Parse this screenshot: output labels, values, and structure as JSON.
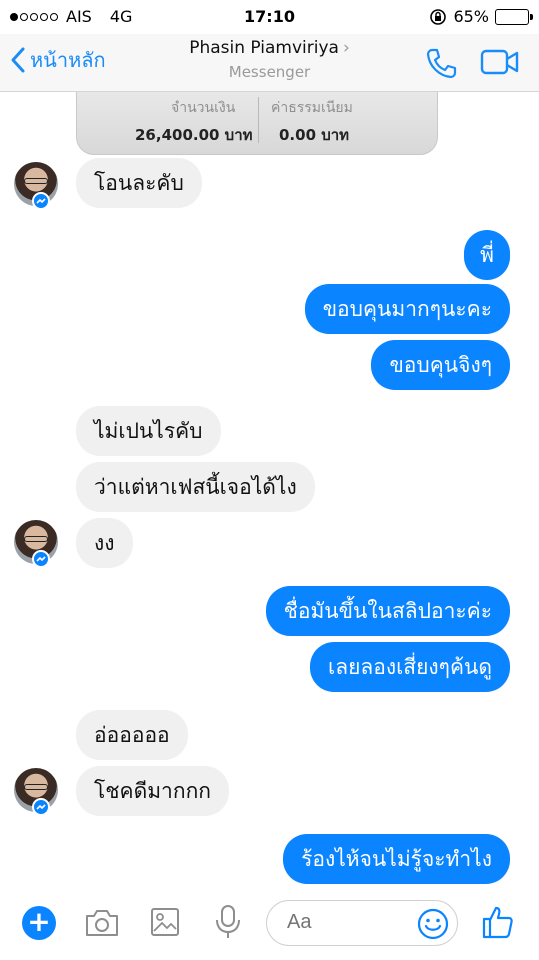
{
  "status_bar": {
    "carrier": "AIS",
    "network": "4G",
    "time": "17:10",
    "battery": "65%",
    "battery_level": 0.65,
    "signal_filled": 1,
    "signal_total": 5
  },
  "nav": {
    "back_label": "หน้าหลัก",
    "contact_name": "Phasin Piamviriya",
    "subtitle": "Messenger"
  },
  "slip": {
    "amount_label": "จำนวนเงิน",
    "fee_label": "ค่าธรรมเนียม",
    "amount_value": "26,400.00 บาท",
    "fee_value": "0.00 บาท"
  },
  "messages": [
    {
      "from": "them",
      "text": "โอนละคับ"
    },
    {
      "from": "me",
      "text": "พี่"
    },
    {
      "from": "me",
      "text": "ขอบคุนมากๆนะคะ"
    },
    {
      "from": "me",
      "text": "ขอบคุนจิงๆ"
    },
    {
      "from": "them",
      "text": "ไม่เปนไรคับ"
    },
    {
      "from": "them",
      "text": "ว่าแต่หาเฟสนี้เจอได้ไง"
    },
    {
      "from": "them",
      "text": "งง"
    },
    {
      "from": "me",
      "text": "ชื่อมันขึ้นในสลิปอาะค่ะ"
    },
    {
      "from": "me",
      "text": "เลยลองเสี่ยงๆค้นดู"
    },
    {
      "from": "them",
      "text": "อ่อออออ"
    },
    {
      "from": "them",
      "text": "โชคดีมากกก"
    },
    {
      "from": "me",
      "text": "ร้องไห้จนไม่รู้จะทำไง"
    }
  ],
  "composer": {
    "placeholder": "Aa"
  },
  "colors": {
    "accent": "#0a84ff",
    "incoming_bubble": "#f0f0f0",
    "nav_bg": "#f7f7f7"
  }
}
